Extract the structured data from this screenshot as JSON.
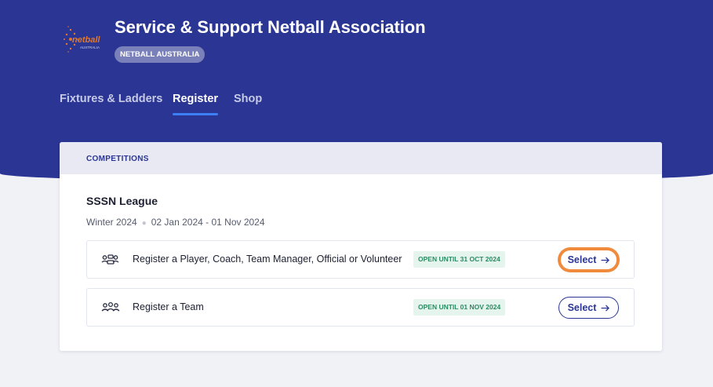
{
  "header": {
    "org_title": "Service & Support Netball Association",
    "org_badge": "NETBALL AUSTRALIA",
    "logo_text": "netball",
    "logo_subtext": "AUSTRALIA"
  },
  "nav": {
    "items": [
      {
        "label": "Fixtures & Ladders",
        "active": false
      },
      {
        "label": "Register",
        "active": true
      },
      {
        "label": "Shop",
        "active": false
      }
    ]
  },
  "card": {
    "section_label": "COMPETITIONS",
    "competition_name": "SSSN League",
    "season": "Winter 2024",
    "date_range": "02 Jan 2024 - 01 Nov 2024",
    "rows": [
      {
        "icon": "people-individual-icon",
        "label": "Register a Player, Coach, Team Manager, Official or Volunteer",
        "status": "OPEN UNTIL 31 OCT 2024",
        "button": "Select"
      },
      {
        "icon": "team-group-icon",
        "label": "Register a Team",
        "status": "OPEN UNTIL 01 NOV 2024",
        "button": "Select"
      }
    ]
  },
  "colors": {
    "header_bg": "#2b3694",
    "nav_active_underline": "#3d7ff5",
    "status_bg": "#e5f5ee",
    "status_text": "#2c8a63",
    "focus_ring": "#f08a3c"
  }
}
